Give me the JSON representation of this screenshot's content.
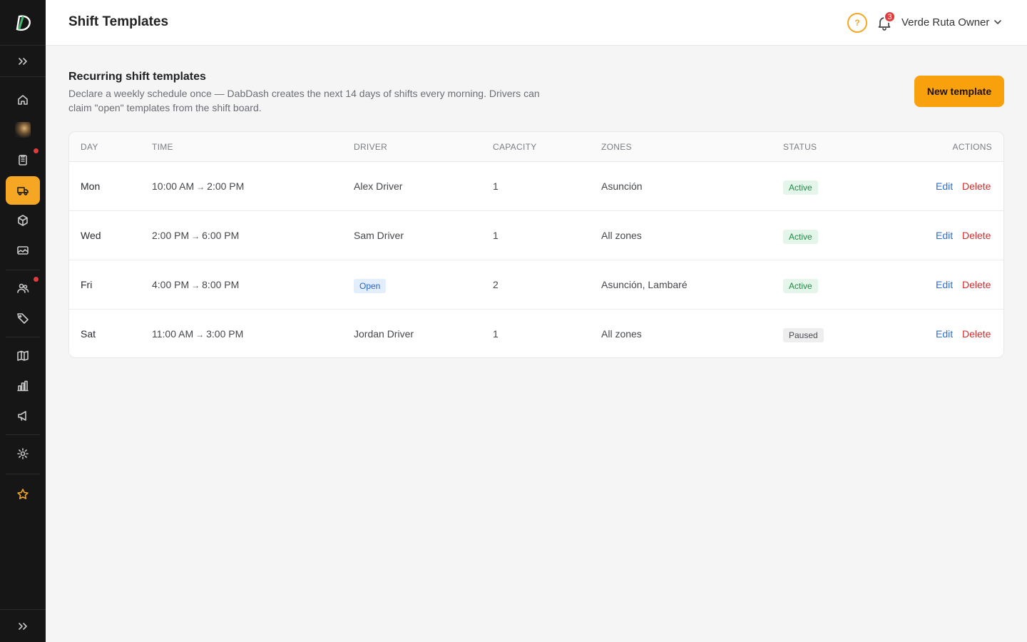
{
  "header": {
    "title": "Shift Templates",
    "help_label": "?",
    "notification_count": "3",
    "user_name": "Verde Ruta Owner"
  },
  "section": {
    "title": "Recurring shift templates",
    "description": "Declare a weekly schedule once — DabDash creates the next 14 days of shifts every morning. Drivers can claim \"open\" templates from the shift board.",
    "new_button": "New template"
  },
  "table": {
    "columns": [
      "DAY",
      "TIME",
      "DRIVER",
      "CAPACITY",
      "ZONES",
      "STATUS",
      "ACTIONS"
    ],
    "arrow": "→",
    "edit_label": "Edit",
    "delete_label": "Delete",
    "rows": [
      {
        "day": "Mon",
        "start": "10:00 AM",
        "end": "2:00 PM",
        "driver": "Alex Driver",
        "capacity": "1",
        "zones": "Asunción",
        "status": "Active"
      },
      {
        "day": "Wed",
        "start": "2:00 PM",
        "end": "6:00 PM",
        "driver": "Sam Driver",
        "capacity": "1",
        "zones": "All zones",
        "status": "Active"
      },
      {
        "day": "Fri",
        "start": "4:00 PM",
        "end": "8:00 PM",
        "driver": "Open",
        "capacity": "2",
        "zones": "Asunción, Lambaré",
        "status": "Active"
      },
      {
        "day": "Sat",
        "start": "11:00 AM",
        "end": "3:00 PM",
        "driver": "Jordan Driver",
        "capacity": "1",
        "zones": "All zones",
        "status": "Paused"
      }
    ]
  },
  "sidebar": {
    "items": [
      {
        "icon": "home-icon"
      },
      {
        "icon": "store-avatar-icon"
      },
      {
        "icon": "orders-clipboard-icon"
      },
      {
        "icon": "delivery-truck-icon"
      },
      {
        "icon": "package-box-icon"
      },
      {
        "icon": "image-gallery-icon"
      },
      {
        "icon": "users-icon"
      },
      {
        "icon": "tag-icon"
      },
      {
        "icon": "map-book-icon"
      },
      {
        "icon": "bar-chart-icon"
      },
      {
        "icon": "megaphone-icon"
      },
      {
        "icon": "settings-gear-icon"
      },
      {
        "icon": "star-icon"
      }
    ]
  },
  "colors": {
    "accent": "#f9a10d",
    "sidebar_bg": "#161616",
    "active_badge": "#1f8a43",
    "link_edit": "#2f6fd6",
    "link_delete": "#d12c2c"
  }
}
